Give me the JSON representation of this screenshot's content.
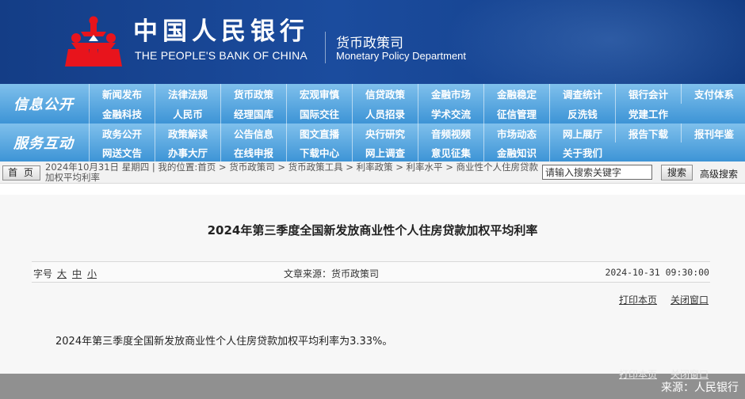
{
  "header": {
    "bank_name_cn": "中国人民银行",
    "bank_name_en": "THE PEOPLE'S BANK OF CHINA",
    "department_cn": "货币政策司",
    "department_en": "Monetary Policy Department",
    "emblem_color": "#e8141c"
  },
  "nav": {
    "info_label": "信息公开",
    "info_items": [
      "新闻发布",
      "法律法规",
      "货币政策",
      "宏观审慎",
      "信贷政策",
      "金融市场",
      "金融稳定",
      "调查统计",
      "银行会计",
      "支付体系",
      "金融科技",
      "人民币",
      "经理国库",
      "国际交往",
      "人员招录",
      "学术交流",
      "征信管理",
      "反洗钱",
      "党建工作"
    ],
    "service_label": "服务互动",
    "service_items": [
      "政务公开",
      "政策解读",
      "公告信息",
      "图文直播",
      "央行研究",
      "音频视频",
      "市场动态",
      "网上展厅",
      "报告下载",
      "报刊年鉴",
      "网送文告",
      "办事大厅",
      "在线申报",
      "下载中心",
      "网上调查",
      "意见征集",
      "金融知识",
      "关于我们"
    ]
  },
  "breadcrumb": {
    "home_label": "首 页",
    "text": "2024年10月31日 星期四 | 我的位置:首页 > 货币政策司 > 货币政策工具 > 利率政策 > 利率水平 > 商业性个人住房贷款加权平均利率",
    "search_placeholder": "请输入搜索关键字",
    "search_button": "搜索",
    "advanced_search": "高级搜索"
  },
  "article": {
    "title": "2024年第三季度全国新发放商业性个人住房贷款加权平均利率",
    "font_size_label": "字号",
    "font_large": "大",
    "font_medium": "中",
    "font_small": "小",
    "source": "文章来源：货币政策司",
    "datetime": "2024-10-31  09:30:00",
    "print_label": "打印本页",
    "close_label": "关闭窗口",
    "body": "2024年第三季度全国新发放商业性个人住房贷款加权平均利率为3.33%。"
  },
  "watermark": "来源：人民银行",
  "colors": {
    "header_blue": "#1b4c9e",
    "nav_blue": "#3d94d6"
  }
}
